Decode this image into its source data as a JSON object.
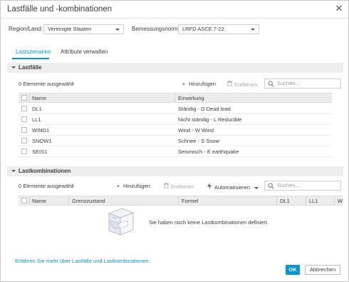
{
  "dialog": {
    "title": "Lastfälle und -kombinationen",
    "close_icon": "close-icon"
  },
  "settings": {
    "region_label": "Region/Land:",
    "region_value": "Vereinigte Staaten",
    "norm_label": "Bemessungsnorm:",
    "norm_value": "LRFD ASCE 7-22"
  },
  "tabs": [
    {
      "label": "Lastszenarien",
      "active": true
    },
    {
      "label": "Attribute verwalten",
      "active": false
    }
  ],
  "loadcases": {
    "section_title": "Lastfälle",
    "selected_count": "0 Elemente ausgewählt",
    "add_label": "Hinzufügen",
    "remove_label": "Entfernen",
    "search_placeholder": "Suchen...",
    "columns": [
      "Name",
      "Einwirkung"
    ],
    "rows": [
      {
        "name": "DL1",
        "action": "Ständig - D Dead load"
      },
      {
        "name": "LL1",
        "action": "Nicht ständig - L Reducible"
      },
      {
        "name": "WIND1",
        "action": "Wind - W Wind"
      },
      {
        "name": "SNOW1",
        "action": "Schnee - S Snow"
      },
      {
        "name": "SEIS1",
        "action": "Seismisch - E earthquake"
      }
    ]
  },
  "combinations": {
    "section_title": "Lastkombinationen",
    "selected_count": "0 Elemente ausgewählt",
    "add_label": "Hinzufügen",
    "remove_label": "Entfernen",
    "automate_label": "Automatisieren",
    "search_placeholder": "Suchen...",
    "columns": [
      "Name",
      "Grenzzustand",
      "Formel",
      "DL1",
      "LL1",
      "W"
    ],
    "empty_message": "Sie haben noch keine Lastkombinationen definiert."
  },
  "footer": {
    "help_link": "Erfahren Sie mehr über Lastfälle und Lastkombinationen.",
    "ok_label": "OK",
    "cancel_label": "Abbrechen"
  },
  "colors": {
    "accent": "#0696d7",
    "section_bg": "#eeeeee",
    "header_bg": "#ececec"
  }
}
